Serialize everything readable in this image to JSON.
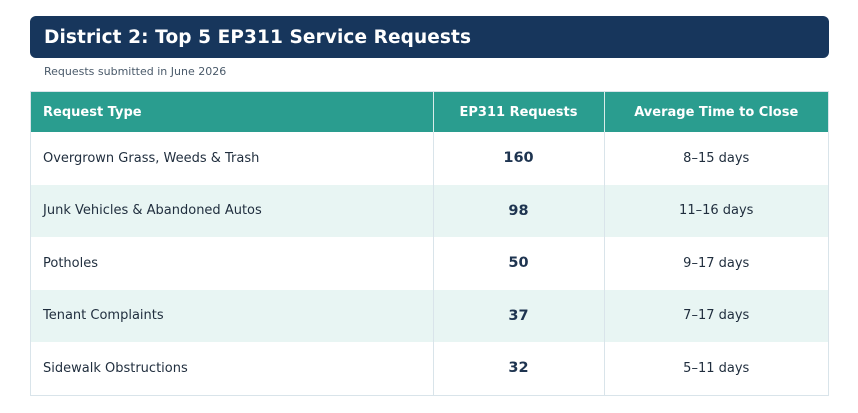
{
  "header": {
    "title": "District 2: Top 5 EP311 Service Requests",
    "subtitle": "Requests submitted in June 2026"
  },
  "table": {
    "columns": [
      "Request Type",
      "EP311 Requests",
      "Average Time to Close"
    ],
    "rows": [
      {
        "type": "Overgrown Grass, Weeds & Trash",
        "requests": "160",
        "time": "8–15 days"
      },
      {
        "type": "Junk Vehicles & Abandoned Autos",
        "requests": "98",
        "time": "11–16 days"
      },
      {
        "type": "Potholes",
        "requests": "50",
        "time": "9–17 days"
      },
      {
        "type": "Tenant Complaints",
        "requests": "37",
        "time": "7–17 days"
      },
      {
        "type": "Sidewalk Obstructions",
        "requests": "32",
        "time": "5–11 days"
      }
    ]
  },
  "colors": {
    "title_bg": "#17365c",
    "header_bg": "#2a9d8f",
    "alt_row_bg": "#e8f5f3"
  }
}
